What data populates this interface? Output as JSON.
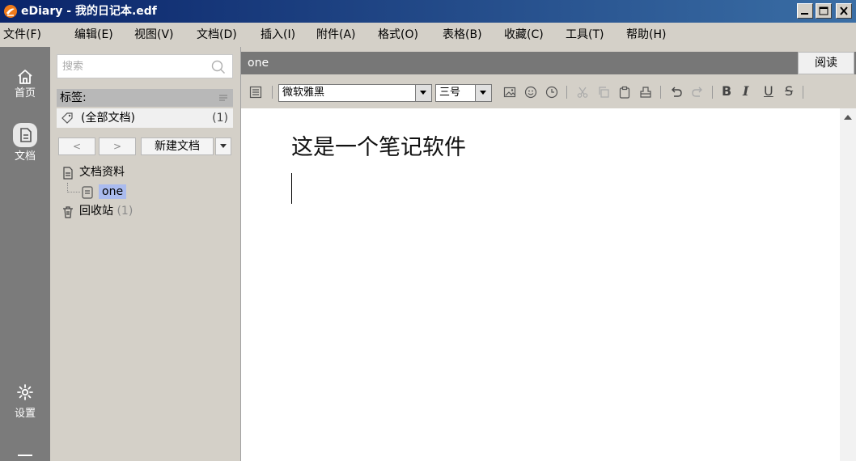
{
  "window": {
    "title": "eDiary - 我的日记本.edf"
  },
  "menu": {
    "items": [
      {
        "label": "文件(F)"
      },
      {
        "label": "编辑(E)"
      },
      {
        "label": "视图(V)"
      },
      {
        "label": "文档(D)"
      },
      {
        "label": "插入(I)"
      },
      {
        "label": "附件(A)"
      },
      {
        "label": "格式(O)"
      },
      {
        "label": "表格(B)"
      },
      {
        "label": "收藏(C)"
      },
      {
        "label": "工具(T)"
      },
      {
        "label": "帮助(H)"
      }
    ]
  },
  "leftnav": {
    "home_label": "首页",
    "docs_label": "文档",
    "settings_label": "设置"
  },
  "sidebar": {
    "search_placeholder": "搜索",
    "tags_title": "标签:",
    "all_docs_label": "(全部文档)",
    "all_docs_count": "(1)",
    "prev_label": "<",
    "next_label": ">",
    "new_doc_label": "新建文档",
    "tree": {
      "folder_label": "文档资料",
      "doc_label": "one",
      "trash_label": "回收站",
      "trash_count": "(1)"
    }
  },
  "editor": {
    "doc_title": "one",
    "read_button": "阅读",
    "font_name": "微软雅黑",
    "font_size": "三号",
    "bold_label": "B",
    "italic_label": "I",
    "underline_label": "U",
    "strike_label": "S",
    "content_heading": "这是一个笔记软件"
  },
  "colors": {
    "titlebar_start": "#0a246a",
    "titlebar_end": "#3a6ea5",
    "leftnav_bg": "#7b7b7b",
    "selection": "#aabbee"
  },
  "icons": {
    "app": "ediary-logo-icon",
    "home": "home-icon",
    "docs": "document-icon",
    "settings": "gear-icon",
    "search": "search-icon",
    "tag": "tag-icon",
    "trash": "trash-icon"
  }
}
